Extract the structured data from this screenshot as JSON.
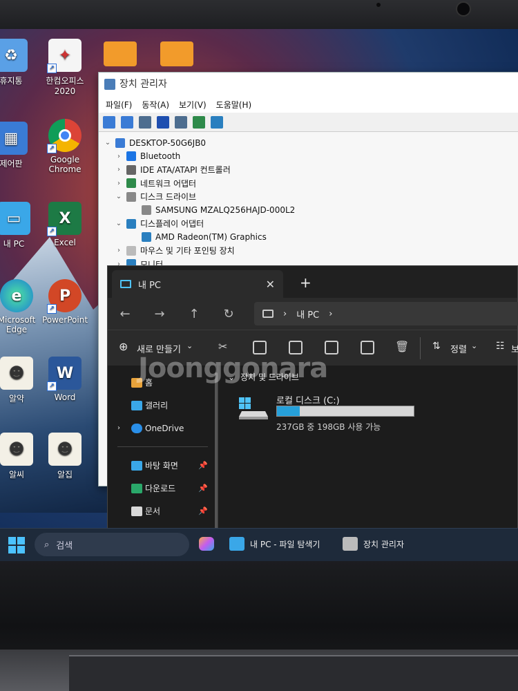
{
  "desktop_icons": [
    {
      "label": "휴지통"
    },
    {
      "label": "한컴오피스 2020"
    },
    {
      "label": "제어판"
    },
    {
      "label": "Google Chrome"
    },
    {
      "label": "내 PC"
    },
    {
      "label": "Excel"
    },
    {
      "label": "Microsoft Edge"
    },
    {
      "label": "PowerPoint"
    },
    {
      "label": "알약"
    },
    {
      "label": "Word"
    },
    {
      "label": "알씨"
    },
    {
      "label": "알집"
    }
  ],
  "device_manager": {
    "title": "장치 관리자",
    "menu": [
      "파일(F)",
      "동작(A)",
      "보기(V)",
      "도움말(H)"
    ],
    "tree": [
      {
        "label": "DESKTOP-50G6JB0",
        "level": 0,
        "expanded": true
      },
      {
        "label": "Bluetooth",
        "level": 1,
        "expanded": false
      },
      {
        "label": "IDE ATA/ATAPI 컨트롤러",
        "level": 1,
        "expanded": false
      },
      {
        "label": "네트워크 어댑터",
        "level": 1,
        "expanded": false
      },
      {
        "label": "디스크 드라이브",
        "level": 1,
        "expanded": true
      },
      {
        "label": "SAMSUNG MZALQ256HAJD-000L2",
        "level": 2
      },
      {
        "label": "디스플레이 어댑터",
        "level": 1,
        "expanded": true
      },
      {
        "label": "AMD Radeon(TM) Graphics",
        "level": 2
      },
      {
        "label": "마우스 및 기타 포인팅 장치",
        "level": 1,
        "expanded": false
      },
      {
        "label": "모니터",
        "level": 1,
        "expanded": false
      }
    ]
  },
  "explorer": {
    "tab_title": "내 PC",
    "address": "내 PC",
    "new_button": "새로 만들기",
    "sort_label": "정렬",
    "view_label": "보",
    "sidebar": [
      {
        "label": "홈"
      },
      {
        "label": "갤러리"
      },
      {
        "label": "OneDrive"
      },
      {
        "label": "바탕 화면"
      },
      {
        "label": "다운로드"
      },
      {
        "label": "문서"
      }
    ],
    "group_title": "장치 및 드라이브",
    "drive": {
      "name": "로컬 디스크 (C:)",
      "space_text": "237GB 중 198GB 사용 가능",
      "used_fraction": 0.165
    }
  },
  "taskbar": {
    "search_placeholder": "검색",
    "items": [
      {
        "label": "내 PC - 파일 탐색기"
      },
      {
        "label": "장치 관리자"
      }
    ]
  },
  "watermark": "Joonggonara",
  "colors": {
    "accent": "#26a0da",
    "taskbar": "#1e2a3a",
    "explorer_bg": "#1c1c1c"
  }
}
